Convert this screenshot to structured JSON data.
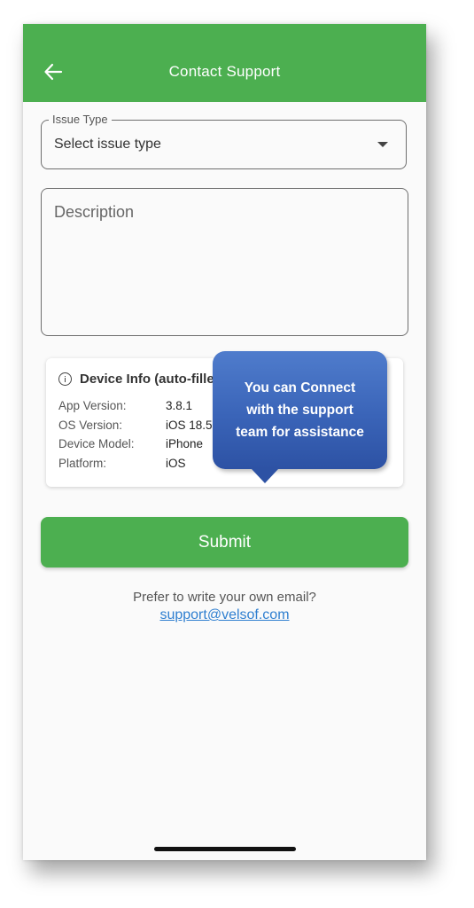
{
  "appbar": {
    "title": "Contact Support",
    "back_icon": "arrow-left-icon",
    "color": "#4caf50"
  },
  "issue_type": {
    "label": "Issue Type",
    "value": "Select issue type",
    "icon": "caret-down-icon"
  },
  "description": {
    "placeholder": "Description"
  },
  "device_info": {
    "icon": "info-circle-icon",
    "title": "Device Info (auto-filled)",
    "rows": [
      {
        "key": "App Version:",
        "value": "3.8.1"
      },
      {
        "key": "OS Version:",
        "value": "iOS 18.5"
      },
      {
        "key": "Device Model:",
        "value": "iPhone"
      },
      {
        "key": "Platform:",
        "value": "iOS"
      }
    ]
  },
  "tooltip": {
    "lines": [
      "You can Connect",
      "with the support",
      "team for assistance"
    ],
    "color": "#3a64b8"
  },
  "submit": {
    "label": "Submit"
  },
  "footer": {
    "prefer_text": "Prefer to write your own email?",
    "email": "support@velsof.com"
  }
}
